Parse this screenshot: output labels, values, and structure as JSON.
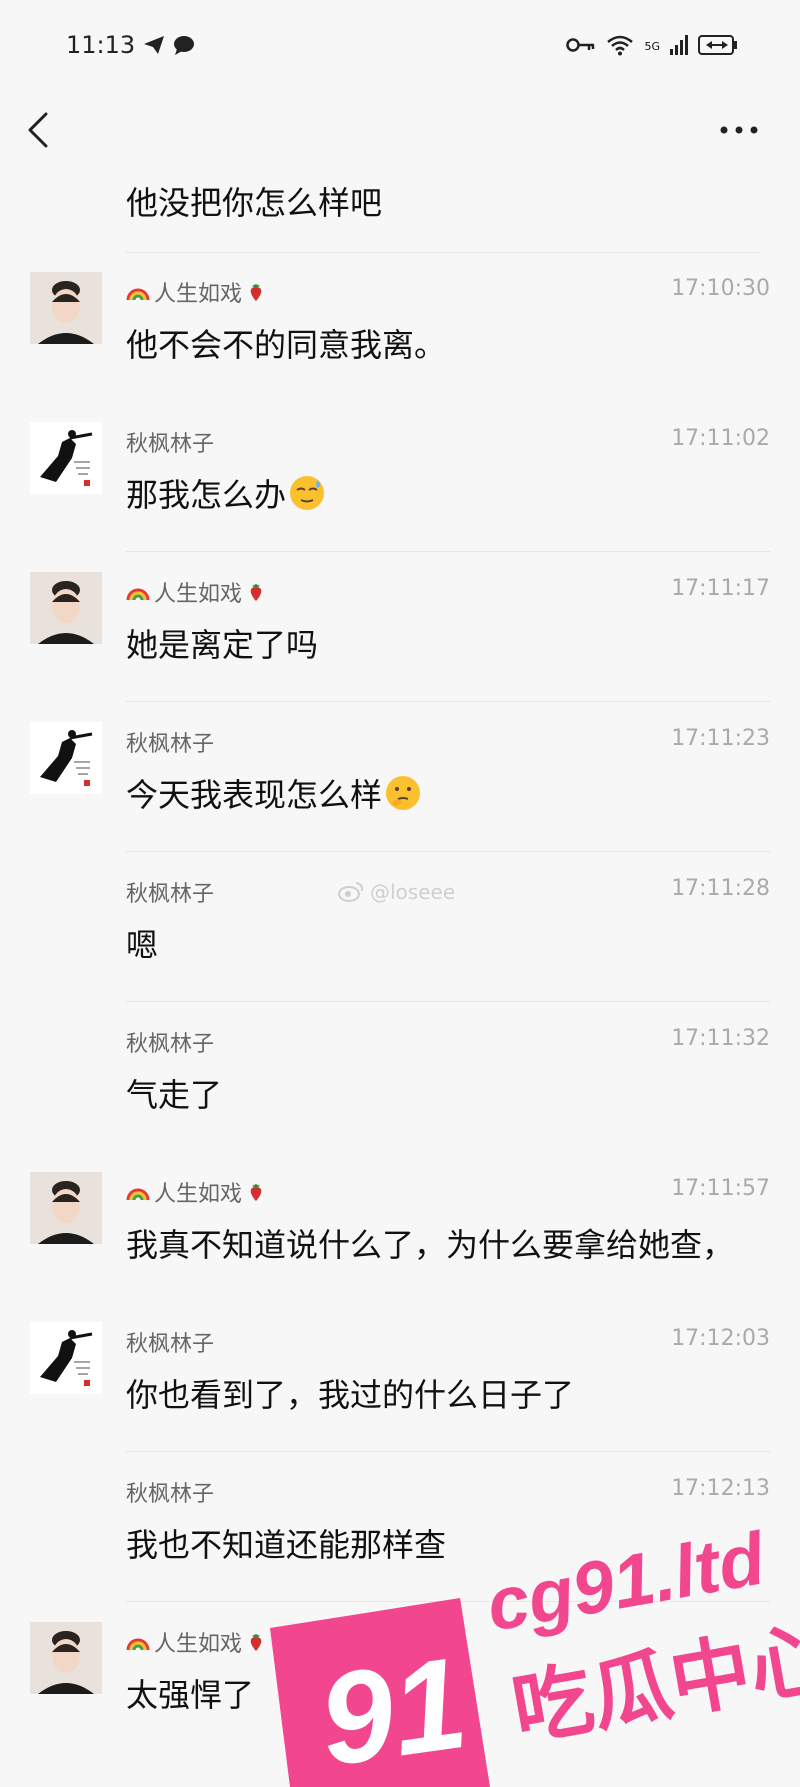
{
  "status_bar": {
    "time": "11:13",
    "network": "5G"
  },
  "conversation": {
    "first_message": "他没把你怎么样吧",
    "messages": [
      {
        "sender": "人生如戏",
        "avatar": "woman",
        "time": "17:10:30",
        "text": "他不会不的同意我离。",
        "emoji": ""
      },
      {
        "sender": "秋枫林子",
        "avatar": "runner",
        "time": "17:11:02",
        "text": "那我怎么办",
        "emoji": "relieved"
      },
      {
        "sender": "人生如戏",
        "avatar": "woman",
        "time": "17:11:17",
        "text": "她是离定了吗",
        "emoji": ""
      },
      {
        "sender": "秋枫林子",
        "avatar": "runner",
        "time": "17:11:23",
        "text": "今天我表现怎么样",
        "emoji": "thinking"
      },
      {
        "sender": "秋枫林子",
        "avatar": "none",
        "time": "17:11:28",
        "text": "嗯",
        "emoji": ""
      },
      {
        "sender": "秋枫林子",
        "avatar": "none",
        "time": "17:11:32",
        "text": "气走了",
        "emoji": ""
      },
      {
        "sender": "人生如戏",
        "avatar": "woman",
        "time": "17:11:57",
        "text": "我真不知道说什么了，为什么要拿给她查，",
        "emoji": ""
      },
      {
        "sender": "秋枫林子",
        "avatar": "runner",
        "time": "17:12:03",
        "text": "你也看到了，我过的什么日子了",
        "emoji": ""
      },
      {
        "sender": "秋枫林子",
        "avatar": "none",
        "time": "17:12:13",
        "text": "我也不知道还能那样查",
        "emoji": ""
      },
      {
        "sender": "人生如戏",
        "avatar": "woman",
        "time": "",
        "text": "太强悍了",
        "emoji": ""
      }
    ]
  },
  "overlays": {
    "weibo_handle": "@loseee",
    "watermark_number": "91",
    "watermark_site": "cg91.ltd",
    "watermark_slogan": "吃瓜中心"
  },
  "colors": {
    "background": "#f7f7f7",
    "divider": "#e6e6e6",
    "watermark_pink": "#f2478e",
    "time_gray": "#aaaaaa"
  },
  "icons": [
    "back-chevron-icon",
    "more-dots-icon",
    "telegram-icon",
    "chat-bubble-icon",
    "key-icon",
    "wifi-icon",
    "signal-icon",
    "battery-icon",
    "rainbow-icon",
    "strawberry-icon",
    "weibo-icon"
  ]
}
